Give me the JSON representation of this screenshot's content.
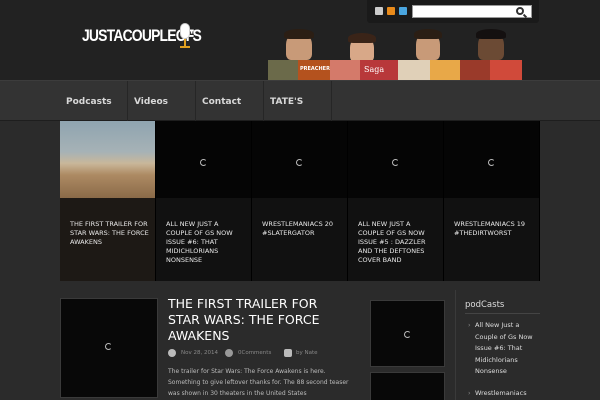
{
  "header": {
    "logo_text": "JUSTACOUPLEOF",
    "logo_suffix": "'S",
    "social": [
      "email-icon",
      "rss-icon",
      "twitter-icon"
    ],
    "search_placeholder": "",
    "banner_books": [
      "PREACHER",
      "Saga"
    ]
  },
  "nav": {
    "items": [
      "Podcasts",
      "Videos",
      "Contact",
      "TATE'S"
    ]
  },
  "slider": {
    "slides": [
      {
        "caption": "THE FIRST TRAILER FOR STAR WARS: THE FORCE AWAKENS"
      },
      {
        "caption": "ALL NEW JUST A COUPLE OF GS NOW ISSUE #6: THAT MIDICHLORIANS NONSENSE"
      },
      {
        "caption": "WRESTLEMANIACS 20 #SLATERGATOR"
      },
      {
        "caption": "ALL NEW JUST A COUPLE OF GS NOW ISSUE #5 : DAZZLER AND THE DEFTONES COVER BAND"
      },
      {
        "caption": "WRESTLEMANIACS 19 #THEDIRTWORST"
      }
    ]
  },
  "post": {
    "title": "THE FIRST TRAILER FOR STAR WARS: THE FORCE AWAKENS",
    "date": "Nov 28, 2014",
    "comments": "0Comments",
    "author": "by Nate",
    "excerpt": "The trailer for Star Wars: The Force Awakens is here. Something to give leftover thanks for. The 88 second teaser was shown in 30 theaters in the United States"
  },
  "sidebar": {
    "title": "podCasts",
    "items": [
      "All New Just a Couple of Gs Now Issue #6: That Midichlorians Nonsense",
      "Wrestlemaniacs"
    ]
  }
}
